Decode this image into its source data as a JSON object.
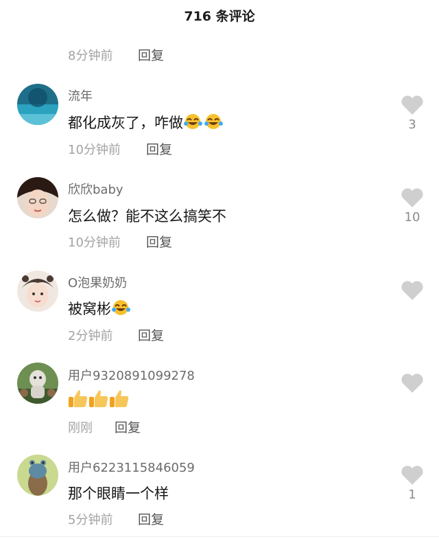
{
  "header": {
    "title": "716 条评论"
  },
  "reply_label": "回复",
  "top_item": {
    "time": "8分钟前"
  },
  "comments": [
    {
      "name": "流年",
      "text": "都化成灰了，咋做",
      "time": "10分钟前",
      "likes": "3",
      "emoji": "laughing-tears-icon"
    },
    {
      "name": "欣欣baby",
      "text": "怎么做？能不这么搞笑不",
      "time": "10分钟前",
      "likes": "10"
    },
    {
      "name": "O泡果奶奶",
      "text": "被窝彬",
      "time": "2分钟前",
      "likes": "",
      "emoji": "laughing-tears-icon"
    },
    {
      "name": "用户9320891099278",
      "text": "",
      "time": "刚刚",
      "likes": "",
      "emoji": "thumbs-up-icon"
    },
    {
      "name": "用户6223115846059",
      "text": "那个眼睛一个样",
      "time": "5分钟前",
      "likes": "1"
    }
  ],
  "colors": {
    "heart": "#cfcfcf",
    "meta": "#a3a3a3"
  }
}
